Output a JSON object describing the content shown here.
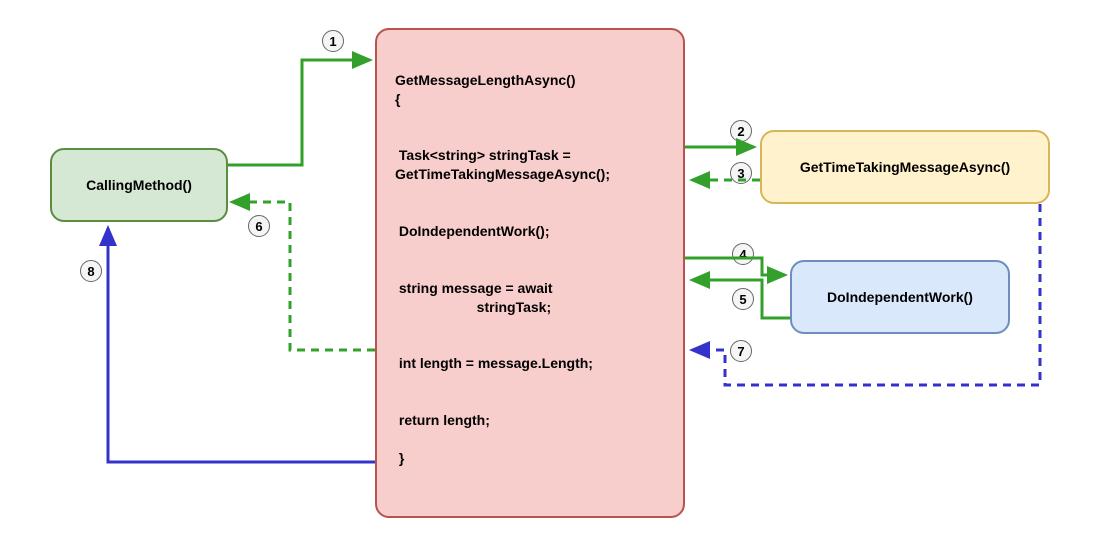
{
  "boxes": {
    "calling": {
      "label": "CallingMethod()"
    },
    "get_time": {
      "label": "GetTimeTakingMessageAsync()"
    },
    "do_work": {
      "label": "DoIndependentWork()"
    }
  },
  "codeLines": {
    "l1": "GetMessageLengthAsync()",
    "l2": "{",
    "l3": " Task<string> stringTask =",
    "l4": "GetTimeTakingMessageAsync();",
    "l5": " DoIndependentWork();",
    "l6": " string message = await",
    "l7": "                     stringTask;",
    "l8": " int length = message.Length;",
    "l9": " return length;",
    "l10": " }"
  },
  "steps": {
    "s1": "1",
    "s2": "2",
    "s3": "3",
    "s4": "4",
    "s5": "5",
    "s6": "6",
    "s7": "7",
    "s8": "8"
  },
  "colors": {
    "greenStroke": "#33a02c",
    "blueStroke": "#3333cc"
  }
}
